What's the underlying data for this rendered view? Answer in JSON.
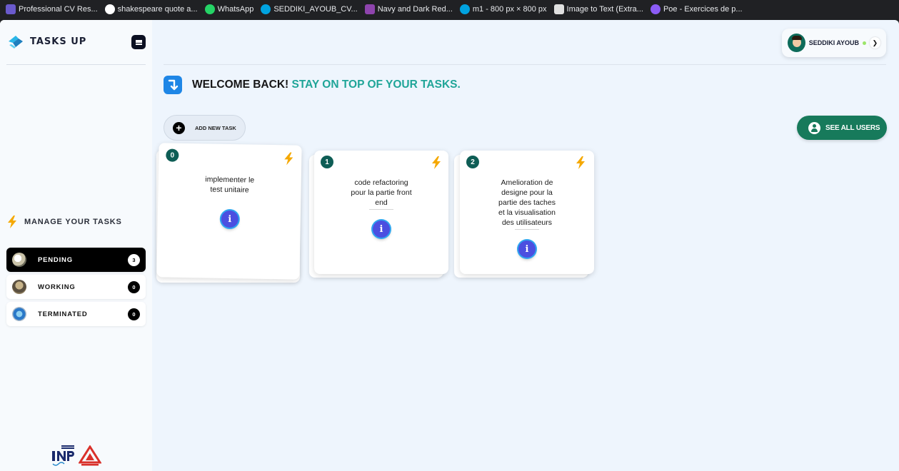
{
  "bookmarks": [
    {
      "label": "Professional CV Res...",
      "color": "#6a5acd"
    },
    {
      "label": "shakespeare quote a...",
      "color": "#4285f4"
    },
    {
      "label": "WhatsApp",
      "color": "#25d366"
    },
    {
      "label": "SEDDIKI_AYOUB_CV...",
      "color": "#00a3e0"
    },
    {
      "label": "Navy and Dark Red...",
      "color": "#8e44ad"
    },
    {
      "label": "m1 - 800 px × 800 px",
      "color": "#00a3e0"
    },
    {
      "label": "Image to Text (Extra...",
      "color": "#e0e0e0"
    },
    {
      "label": "Poe - Exercices de p...",
      "color": "#8b5cf6"
    }
  ],
  "brand": {
    "name": "TASKS UP"
  },
  "sidebar": {
    "section_title": "MANAGE YOUR TASKS",
    "statuses": [
      {
        "label": "PENDING",
        "count": "3",
        "active": true
      },
      {
        "label": "WORKING",
        "count": "0",
        "active": false
      },
      {
        "label": "TERMINATED",
        "count": "0",
        "active": false
      }
    ]
  },
  "user": {
    "name": "SEDDIKI AYOUB"
  },
  "welcome": {
    "prefix": "WELCOME BACK!",
    "accent": "STAY ON TOP OF YOUR TASKS."
  },
  "actions": {
    "add_task": "ADD NEW TASK",
    "see_users": "SEE ALL USERS"
  },
  "tasks": [
    {
      "index": "0",
      "title_lines": [
        "implementer le",
        "test unitaire"
      ]
    },
    {
      "index": "1",
      "title_lines": [
        "code refactoring",
        "pour la partie front",
        "end"
      ]
    },
    {
      "index": "2",
      "title_lines": [
        "Amelioration de",
        "designe pour la",
        "partie des taches",
        "et la visualisation",
        "des utilisateurs"
      ]
    }
  ],
  "colors": {
    "accent": "#1fa598",
    "primary_button": "#177a5b",
    "card_index": "#0e5d55",
    "bolt": "#f5a800"
  }
}
